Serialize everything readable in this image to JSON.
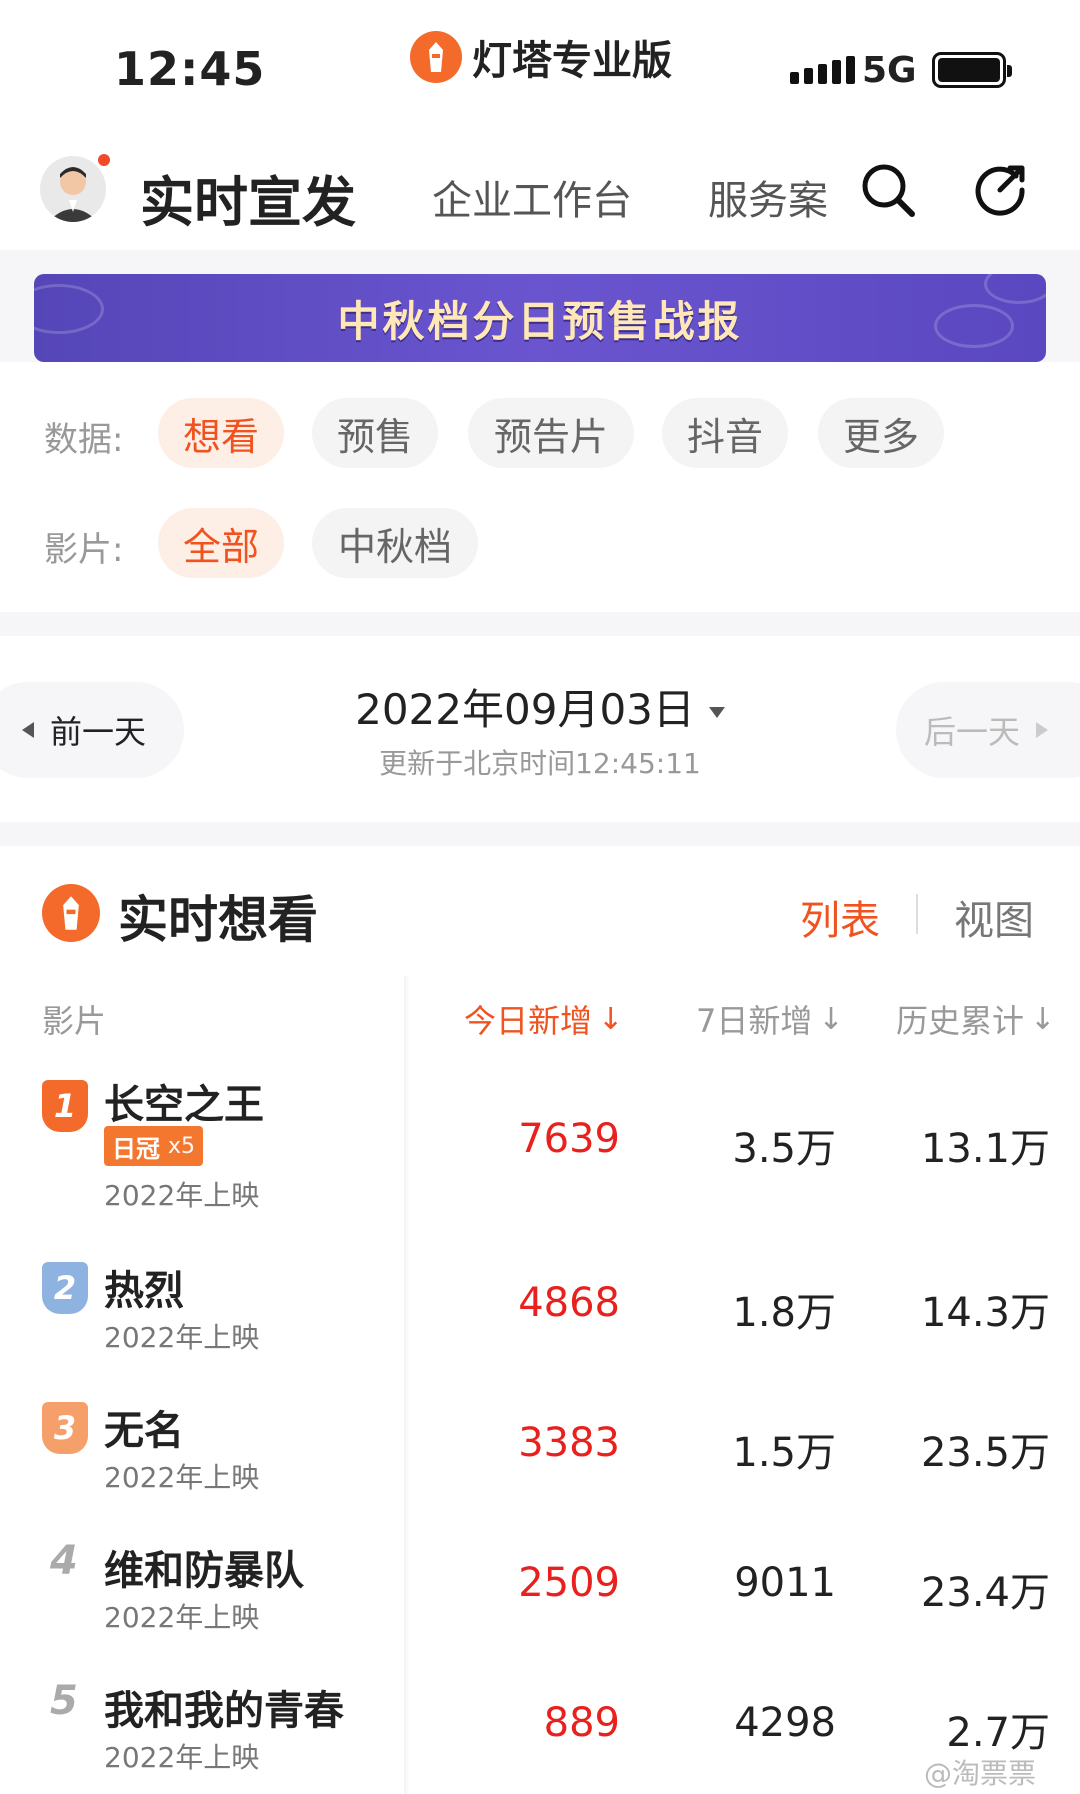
{
  "status_bar": {
    "time": "12:45",
    "app_brand": "灯塔专业版",
    "network": "5G",
    "battery_level": 1.0
  },
  "header": {
    "title": "实时宣发",
    "tabs": [
      "企业工作台",
      "服务案"
    ]
  },
  "banner": {
    "text": "中秋档分日预售战报"
  },
  "filters": {
    "data_label": "数据:",
    "data_options": [
      "想看",
      "预售",
      "预告片",
      "抖音",
      "更多"
    ],
    "data_selected": 0,
    "film_label": "影片:",
    "film_options": [
      "全部",
      "中秋档"
    ],
    "film_selected": 0
  },
  "date_nav": {
    "prev_label": "前一天",
    "next_label": "后一天",
    "date": "2022年09月03日",
    "updated": "更新于北京时间12:45:11"
  },
  "section": {
    "title": "实时想看",
    "view_list": "列表",
    "view_chart": "视图"
  },
  "table": {
    "columns": [
      "影片",
      "今日新增",
      "7日新增",
      "历史累计"
    ],
    "rows": [
      {
        "rank": "1",
        "name": "长空之王",
        "crown_label": "日冠",
        "crown_count": "x5",
        "year": "2022年上映",
        "today": "7639",
        "week": "3.5万",
        "total": "13.1万"
      },
      {
        "rank": "2",
        "name": "热烈",
        "year": "2022年上映",
        "today": "4868",
        "week": "1.8万",
        "total": "14.3万"
      },
      {
        "rank": "3",
        "name": "无名",
        "year": "2022年上映",
        "today": "3383",
        "week": "1.5万",
        "total": "23.5万"
      },
      {
        "rank": "4",
        "name": "维和防暴队",
        "year": "2022年上映",
        "today": "2509",
        "week": "9011",
        "total": "23.4万"
      },
      {
        "rank": "5",
        "name": "我和我的青春",
        "year": "2022年上映",
        "today": "889",
        "week": "4298",
        "total": "2.7万"
      }
    ]
  },
  "watermark": "@淘票票",
  "colors": {
    "accent": "#f0531f",
    "today_value": "#e8211f",
    "banner": "#5a48c0",
    "rank1": "#f36a2b",
    "rank2": "#8fb3e0",
    "rank3": "#f5a06b"
  }
}
